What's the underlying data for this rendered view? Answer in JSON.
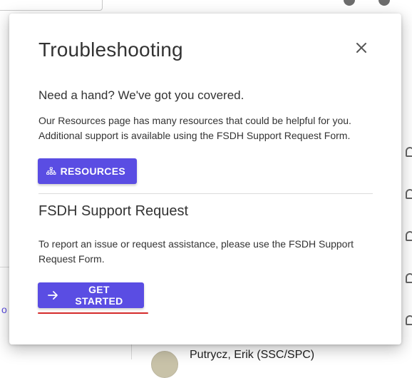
{
  "background": {
    "edge_link_fragment": "o",
    "person_name": "Putrycz, Erik (SSC/SPC)"
  },
  "dialog": {
    "title": "Troubleshooting",
    "close_label": "×",
    "lead": "Need a hand? We've got you covered.",
    "resources_text": "Our Resources page has many resources that could be helpful for you. Additional support is available using the FSDH Support Request Form.",
    "resources_button": "RESOURCES",
    "support_title": "FSDH Support Request",
    "support_text": "To report an issue or request assistance, please use the FSDH Support Request Form.",
    "get_started_button": "GET STARTED"
  },
  "colors": {
    "primary": "#5a4de3",
    "annotation_underline": "#d42a2a"
  },
  "icons": {
    "resources_button_icon": "sitemap-icon",
    "get_started_button_icon": "arrow-right-icon",
    "close_icon": "close-icon"
  }
}
